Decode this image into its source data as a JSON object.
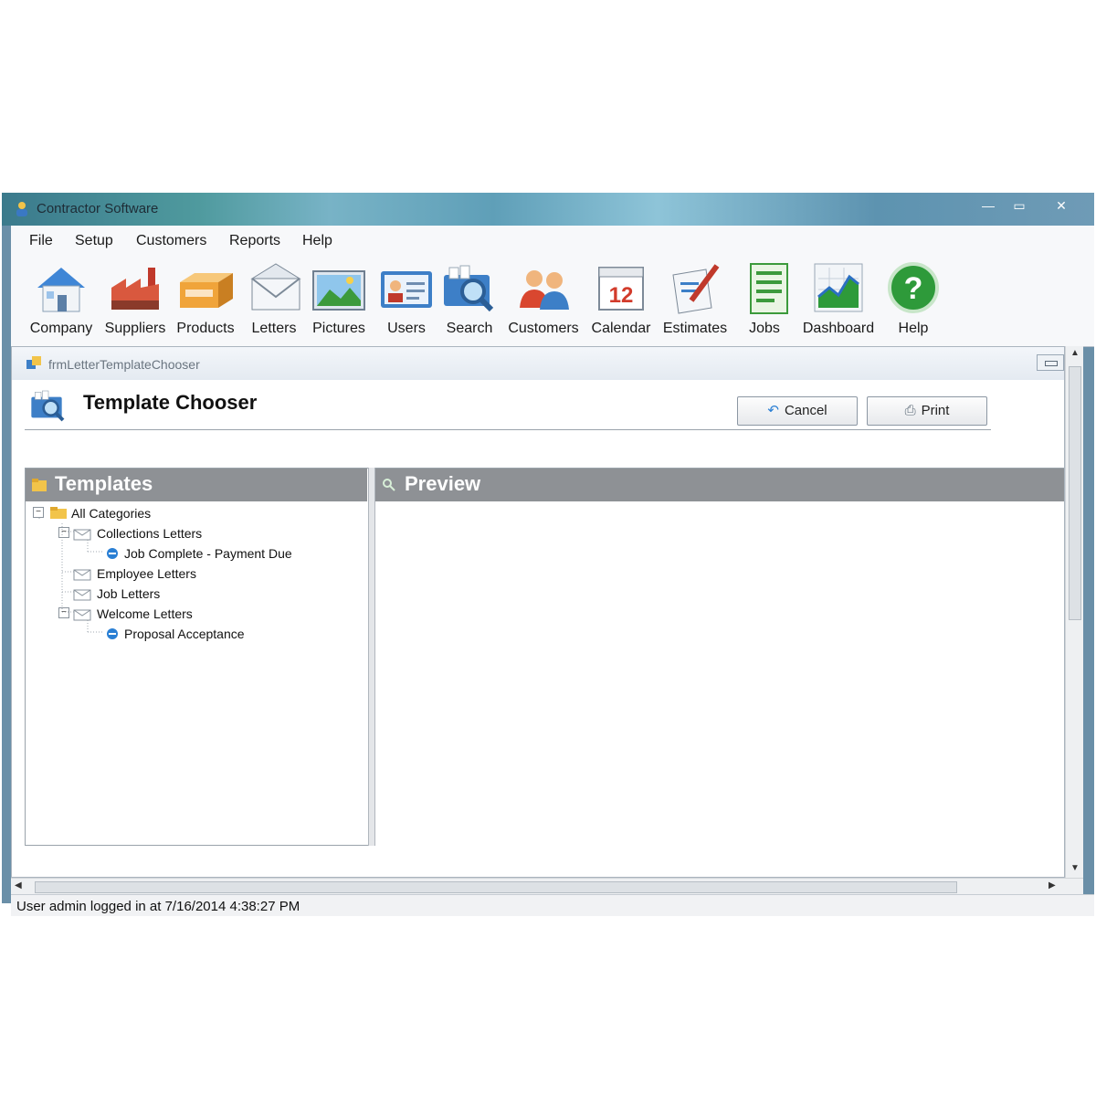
{
  "window": {
    "title": "Contractor Software",
    "controls": {
      "minimize": "—",
      "maximize": "▭",
      "close": "✕"
    }
  },
  "menu": [
    "File",
    "Setup",
    "Customers",
    "Reports",
    "Help"
  ],
  "toolbar": [
    {
      "label": "Company",
      "icon": "house-icon"
    },
    {
      "label": "Suppliers",
      "icon": "factory-icon"
    },
    {
      "label": "Products",
      "icon": "box-icon"
    },
    {
      "label": "Letters",
      "icon": "envelope-icon"
    },
    {
      "label": "Pictures",
      "icon": "picture-icon"
    },
    {
      "label": "Users",
      "icon": "user-card-icon"
    },
    {
      "label": "Search",
      "icon": "search-icon"
    },
    {
      "label": "Customers",
      "icon": "people-icon"
    },
    {
      "label": "Calendar",
      "icon": "calendar-icon"
    },
    {
      "label": "Estimates",
      "icon": "pen-paper-icon"
    },
    {
      "label": "Jobs",
      "icon": "list-icon"
    },
    {
      "label": "Dashboard",
      "icon": "chart-icon"
    },
    {
      "label": "Help",
      "icon": "question-icon"
    }
  ],
  "calendar_day": "12",
  "form": {
    "window_title": "frmLetterTemplateChooser",
    "header_title": "Template Chooser",
    "cancel_label": "Cancel",
    "print_label": "Print"
  },
  "templates_panel": {
    "title": "Templates",
    "tree": {
      "root": "All Categories",
      "collections": "Collections Letters",
      "job_complete": "Job Complete - Payment Due",
      "employee": "Employee Letters",
      "job": "Job Letters",
      "welcome": "Welcome Letters",
      "proposal": "Proposal Acceptance"
    }
  },
  "preview_panel": {
    "title": "Preview"
  },
  "status": {
    "text": "User admin logged in at 7/16/2014 4:38:27 PM"
  },
  "colors": {
    "panel_header": "#8e9195",
    "window_frame": "#6a8fa8",
    "accent_blue": "#2a7fd4"
  }
}
